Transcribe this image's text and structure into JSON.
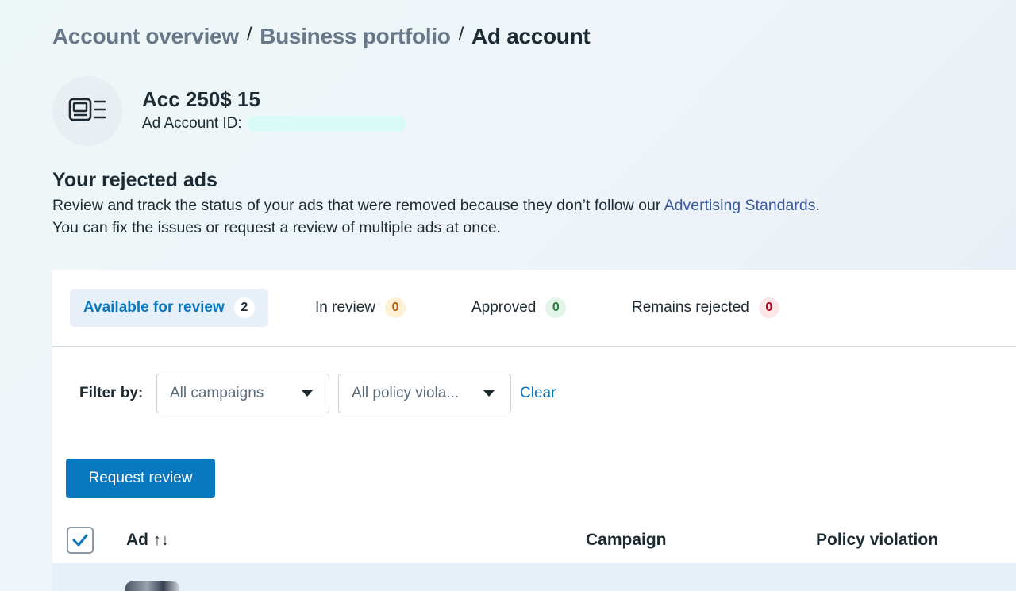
{
  "breadcrumb": {
    "items": [
      "Account overview",
      "Business portfolio"
    ],
    "current": "Ad account",
    "separator": "/"
  },
  "account": {
    "name": "Acc 250$ 15",
    "id_label": "Ad Account ID:",
    "icon": "ad-account-icon"
  },
  "section": {
    "title": "Your rejected ads",
    "desc_part1": "Review and track the status of your ads that were removed because they don’t follow our ",
    "desc_link": "Advertising Standards",
    "desc_part2": ".",
    "desc_line2": "You can fix the issues or request a review of multiple ads at once."
  },
  "tabs": [
    {
      "label": "Available for review",
      "count": "2",
      "active": true
    },
    {
      "label": "In review",
      "count": "0"
    },
    {
      "label": "Approved",
      "count": "0"
    },
    {
      "label": "Remains rejected",
      "count": "0"
    }
  ],
  "filters": {
    "label": "Filter by:",
    "campaigns": "All campaigns",
    "policy": "All policy viola...",
    "clear": "Clear"
  },
  "actions": {
    "request_review": "Request review"
  },
  "table": {
    "headers": {
      "ad": "Ad",
      "campaign": "Campaign",
      "policy": "Policy violation"
    },
    "sort_glyph": "↑↓"
  },
  "colors": {
    "accent": "#0a78be",
    "link": "#385898",
    "text": "#1c2b33",
    "muted": "#67788a"
  }
}
